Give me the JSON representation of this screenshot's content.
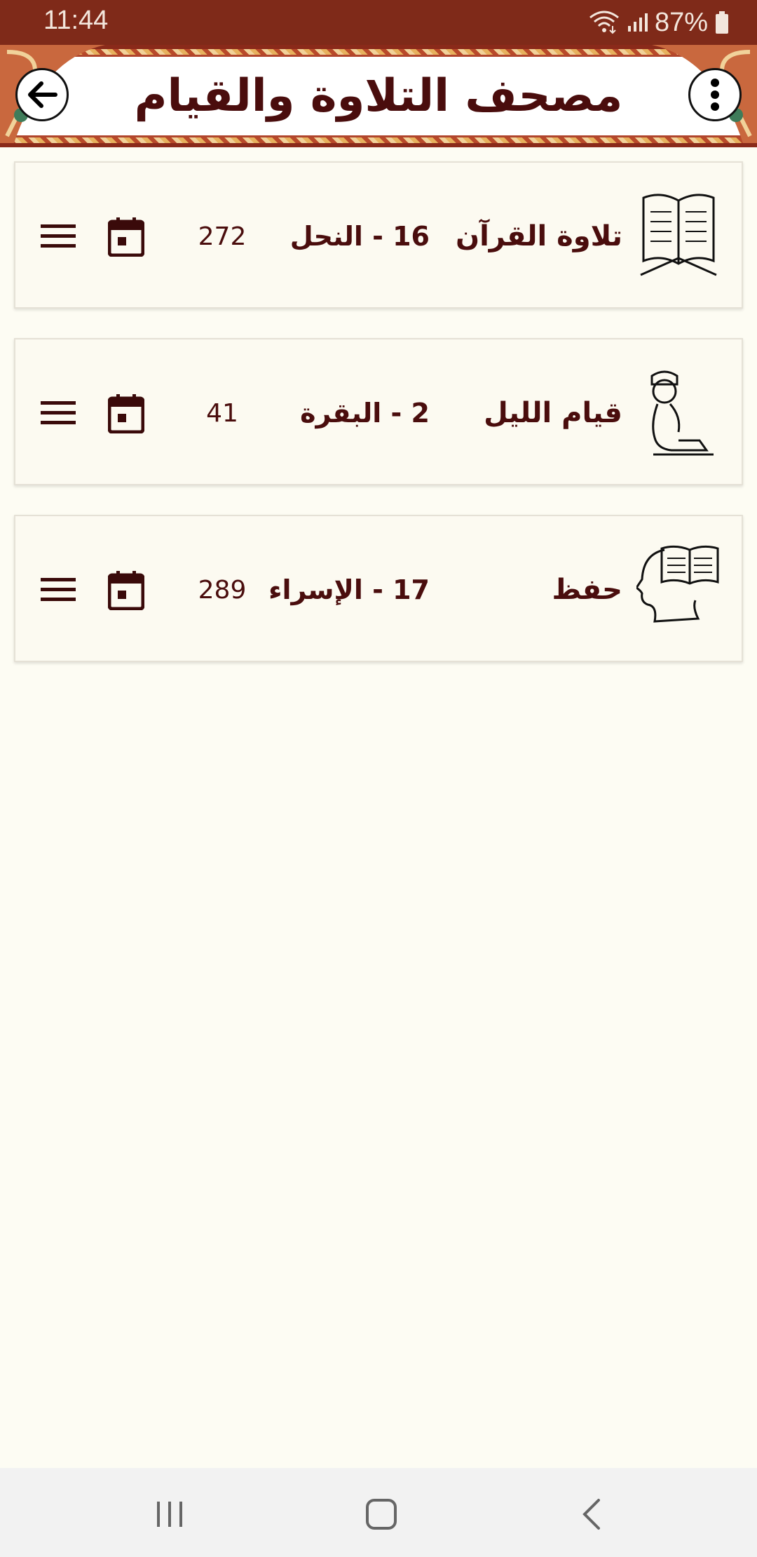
{
  "status_bar": {
    "time": "11:44",
    "battery": "87%",
    "icons": [
      "wifi-icon",
      "signal-icon",
      "battery-icon"
    ]
  },
  "header": {
    "title": "مصحف التلاوة والقيام",
    "left_button_icon": "arrow-left-icon",
    "right_button_icon": "more-vertical-icon"
  },
  "items": [
    {
      "label": "تلاوة القرآن",
      "surah": "16 - النحل",
      "page": "272",
      "icon": "open-book-icon"
    },
    {
      "label": "قيام الليل",
      "surah": "2 - البقرة",
      "page": "41",
      "icon": "praying-person-icon"
    },
    {
      "label": "حفظ",
      "surah": "17 - الإسراء",
      "page": "289",
      "icon": "head-book-icon"
    }
  ],
  "colors": {
    "status_bar": "#7f2a19",
    "text": "#4a0d0d",
    "background": "#fdfcf3",
    "header_frame": "#8a2a1a"
  }
}
